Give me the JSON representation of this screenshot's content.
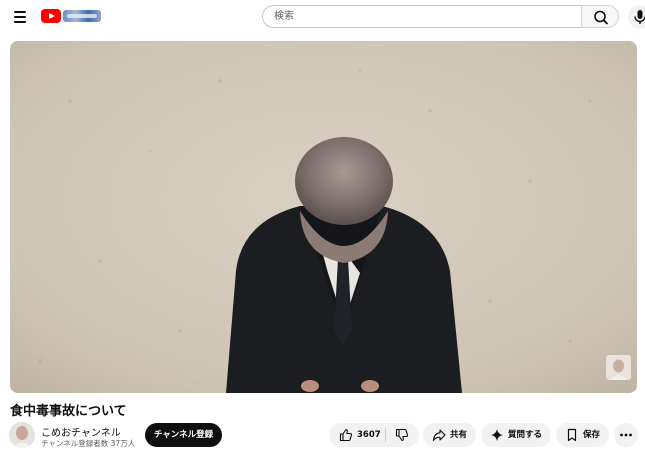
{
  "header": {
    "menu_icon": "hamburger-menu-icon",
    "logo_icon": "youtube-logo-icon",
    "search_placeholder": "検索",
    "search_icon": "search-icon",
    "mic_icon": "microphone-icon"
  },
  "video": {
    "title": "食中毒事故について",
    "thumbnail_description_icon": "channel-watermark"
  },
  "channel": {
    "name": "こめおチャンネル",
    "subscribers": "チャンネル登録者数 37万人",
    "subscribe_label": "チャンネル登録"
  },
  "actions": {
    "like_count": "3607",
    "share_label": "共有",
    "ask_label": "質問する",
    "save_label": "保存"
  },
  "colors": {
    "accent": "#ff0000",
    "text": "#0f0f0f",
    "secondary_text": "#606060",
    "pill_bg": "#f2f2f2",
    "subscribe_bg": "#0f0f0f"
  }
}
